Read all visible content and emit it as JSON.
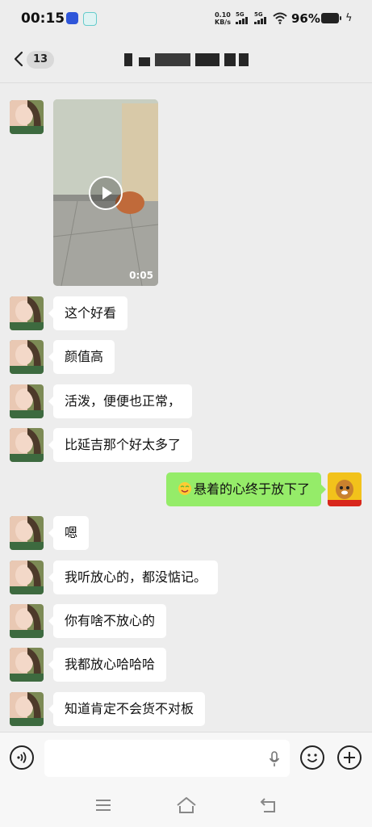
{
  "status_bar": {
    "time": "00:15",
    "net_speed_value": "0.10",
    "net_speed_unit": "KB/s",
    "sim1": "5G",
    "sim2": "5G",
    "battery": "96%"
  },
  "header": {
    "back_label": "<",
    "unread_count": "13",
    "title_redacted": true
  },
  "messages": [
    {
      "side": "left",
      "type": "video",
      "duration": "0:05"
    },
    {
      "side": "left",
      "type": "text",
      "text": "这个好看"
    },
    {
      "side": "left",
      "type": "text",
      "text": "颜值高"
    },
    {
      "side": "left",
      "type": "text",
      "text": "活泼，便便也正常，"
    },
    {
      "side": "left",
      "type": "text",
      "text": "比延吉那个好太多了"
    },
    {
      "side": "right",
      "type": "text",
      "emoji": "relieved-emoji",
      "text": "悬着的心终于放下了"
    },
    {
      "side": "left",
      "type": "text",
      "text": "嗯"
    },
    {
      "side": "left",
      "type": "text",
      "text": "我听放心的，都没惦记。"
    },
    {
      "side": "left",
      "type": "text",
      "text": "你有啥不放心的"
    },
    {
      "side": "left",
      "type": "text",
      "text": "我都放心哈哈哈"
    },
    {
      "side": "left",
      "type": "text",
      "text": "知道肯定不会货不对板"
    }
  ],
  "my_avatar_caption": "暴富赚钱团队",
  "input_bar": {
    "voice_icon": "voice-icon",
    "mic_icon": "mic-icon",
    "emoji_icon": "smiley-icon",
    "plus_icon": "plus-icon"
  },
  "nav": {
    "menu": "menu-icon",
    "home": "home-icon",
    "back": "back-icon"
  },
  "colors": {
    "background": "#ededed",
    "my_bubble": "#95ec69",
    "their_bubble": "#ffffff"
  }
}
